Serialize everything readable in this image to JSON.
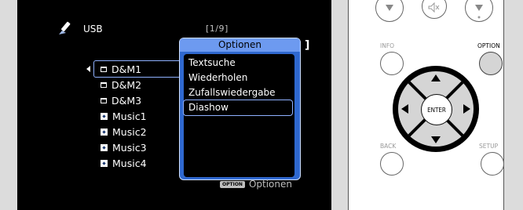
{
  "screen": {
    "source_label": "USB",
    "page_indicator": "[1/9]",
    "partial_bracket": "]",
    "files": [
      {
        "type": "folder",
        "label": "D&M1",
        "selected": true
      },
      {
        "type": "folder",
        "label": "D&M2",
        "selected": false
      },
      {
        "type": "folder",
        "label": "D&M3",
        "selected": false
      },
      {
        "type": "music",
        "label": "Music1",
        "selected": false
      },
      {
        "type": "music",
        "label": "Music2",
        "selected": false
      },
      {
        "type": "music",
        "label": "Music3",
        "selected": false
      },
      {
        "type": "music",
        "label": "Music4",
        "selected": false
      }
    ],
    "options_menu": {
      "title": "Optionen",
      "items": [
        "Textsuche",
        "Wiederholen",
        "Zufallswiedergabe",
        "Diashow"
      ],
      "selected_index": 3
    },
    "option_badge": "OPTION",
    "option_hint": "Optionen"
  },
  "remote": {
    "info_label": "INFO",
    "option_label": "OPTION",
    "enter_label": "ENTER",
    "back_label": "BACK",
    "setup_label": "SETUP"
  },
  "colors": {
    "screen_bg": "#000000",
    "panel_blue": "#2f68cf",
    "highlight": "#8fb1ff",
    "remote_grey": "#d5d5d5"
  }
}
